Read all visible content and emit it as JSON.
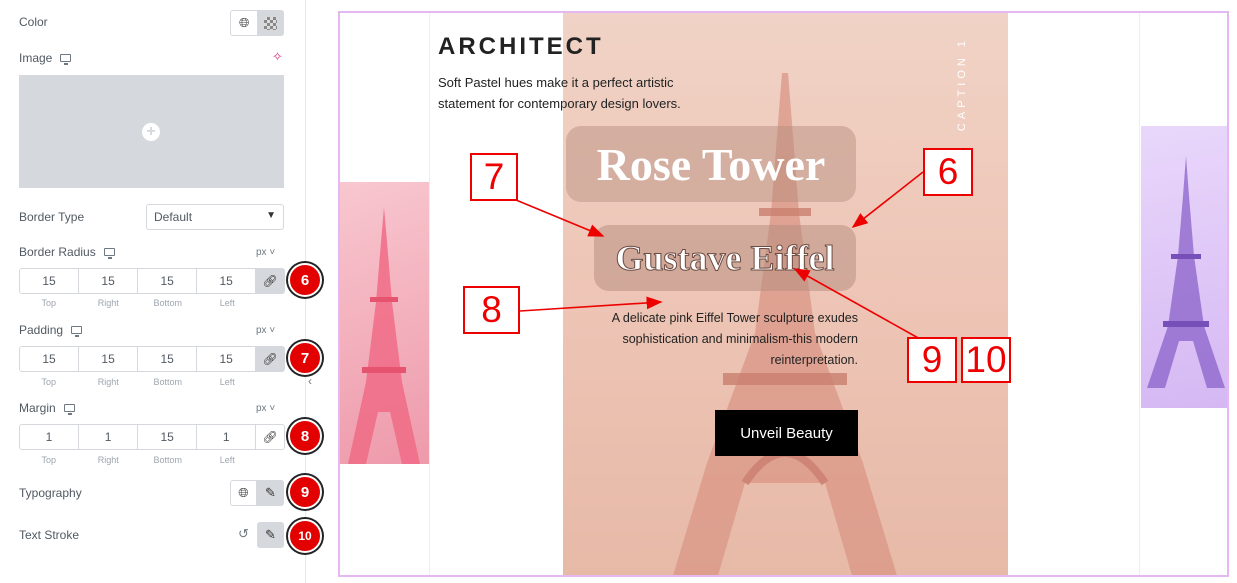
{
  "panel": {
    "color_label": "Color",
    "image_label": "Image",
    "border_type_label": "Border Type",
    "border_type_value": "Default",
    "border_radius": {
      "label": "Border Radius",
      "unit": "px",
      "top": "15",
      "right": "15",
      "bottom": "15",
      "left": "15"
    },
    "padding": {
      "label": "Padding",
      "unit": "px",
      "top": "15",
      "right": "15",
      "bottom": "15",
      "left": "15"
    },
    "margin": {
      "label": "Margin",
      "unit": "px",
      "top": "1",
      "right": "1",
      "bottom": "15",
      "left": "1"
    },
    "side_labels": {
      "top": "Top",
      "right": "Right",
      "bottom": "Bottom",
      "left": "Left"
    },
    "typography_label": "Typography",
    "text_stroke_label": "Text Stroke"
  },
  "badges": {
    "b6": "6",
    "b7": "7",
    "b8": "8",
    "b9": "9",
    "b10": "10"
  },
  "slide": {
    "title": "ARCHITECT",
    "description": "Soft Pastel hues make it a perfect artistic statement for contemporary design lovers.",
    "caption": "CAPTION 1",
    "heading": "Rose Tower",
    "subheading": "Gustave Eiffel",
    "body": "A delicate pink Eiffel Tower sculpture exudes sophistication and minimalism-this modern reinterpretation.",
    "button": "Unveil Beauty"
  },
  "annotations": {
    "a7": "7",
    "a6": "6",
    "a8": "8",
    "a9": "9",
    "a10": "10"
  },
  "colors": {
    "accent": "#e20000",
    "canvas_border": "#e6b8f1",
    "button_bg": "#000000"
  }
}
